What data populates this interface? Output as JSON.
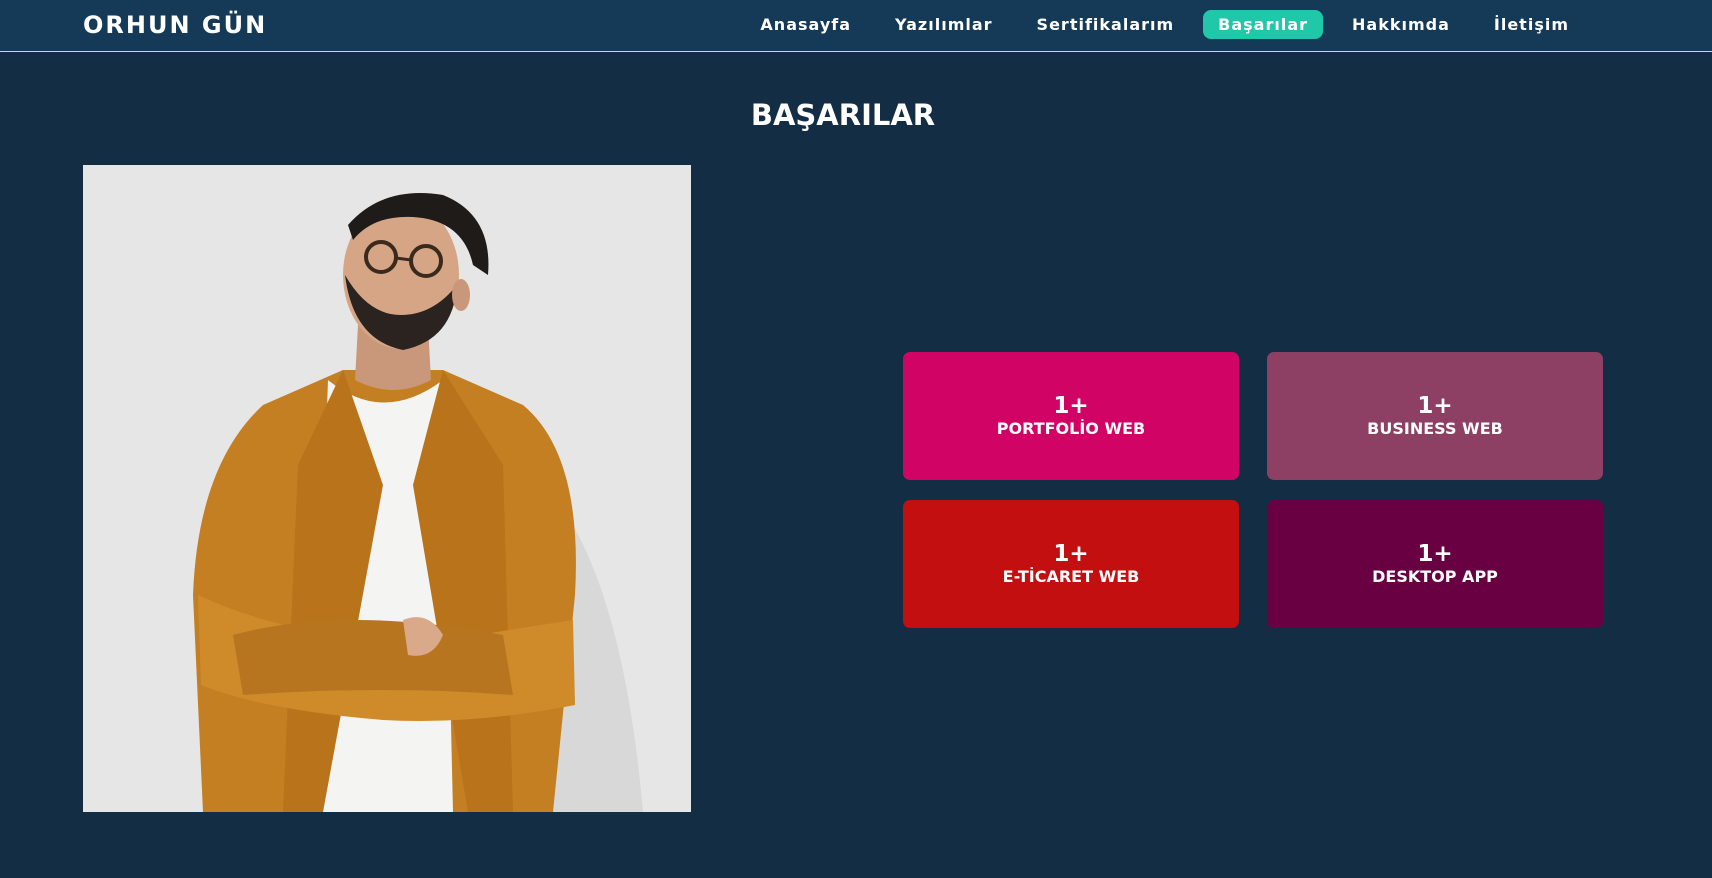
{
  "navbar": {
    "brand": "ORHUN GÜN",
    "links": [
      {
        "label": "Anasayfa",
        "active": false
      },
      {
        "label": "Yazılımlar",
        "active": false
      },
      {
        "label": "Sertifikalarım",
        "active": false
      },
      {
        "label": "Başarılar",
        "active": true
      },
      {
        "label": "Hakkımda",
        "active": false
      },
      {
        "label": "İletişim",
        "active": false
      }
    ],
    "active_color": "#1ec8a8",
    "background": "#143a57"
  },
  "section": {
    "title": "BAŞARILAR"
  },
  "stats": [
    {
      "count": "1+",
      "label": "PORTFOLİO WEB",
      "color": "#d10466"
    },
    {
      "count": "1+",
      "label": "BUSINESS WEB",
      "color": "#8d3f64"
    },
    {
      "count": "1+",
      "label": "E-TİCARET WEB",
      "color": "#c30f10"
    },
    {
      "count": "1+",
      "label": "DESKTOP APP",
      "color": "#680042"
    }
  ],
  "page": {
    "background": "#132d45"
  }
}
